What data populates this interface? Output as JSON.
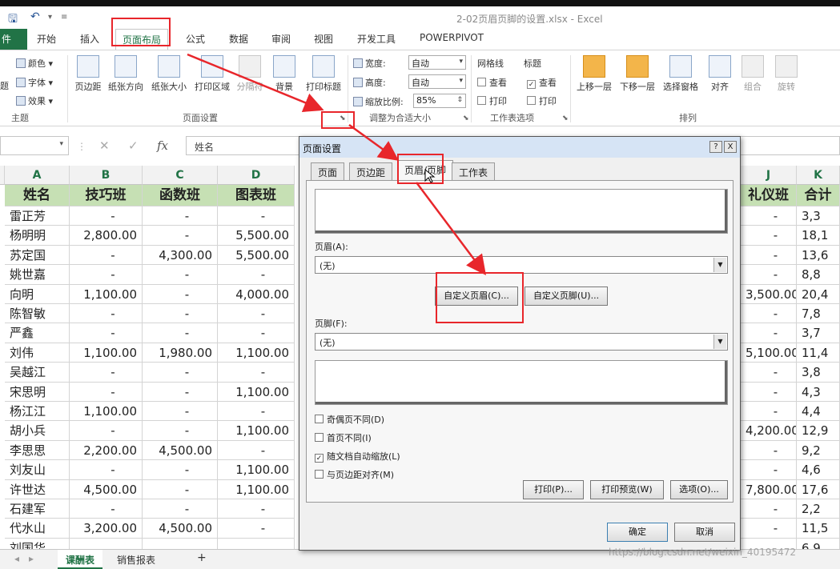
{
  "window": {
    "title": "2-02页眉页脚的设置.xlsx - Excel"
  },
  "ribbon_tabs": [
    "件",
    "开始",
    "插入",
    "页面布局",
    "公式",
    "数据",
    "审阅",
    "视图",
    "开发工具",
    "POWERPIVOT"
  ],
  "ribbon": {
    "theme": {
      "colors": "颜色 ▾",
      "fonts": "字体 ▾",
      "effects": "效果 ▾",
      "partial": "题",
      "group": "主题"
    },
    "page_setup": {
      "margins": "页边距",
      "orientation": "纸张方向",
      "size": "纸张大小",
      "print_area": "打印区域",
      "breaks": "分隔符",
      "background": "背景",
      "print_titles": "打印标题",
      "group": "页面设置"
    },
    "scale_to_fit": {
      "width_label": "宽度:",
      "width_value": "自动",
      "height_label": "高度:",
      "height_value": "自动",
      "scale_label": "缩放比例:",
      "scale_value": "85%",
      "group": "调整为合适大小"
    },
    "sheet_options": {
      "gridlines": "网格线",
      "headings": "标题",
      "view": "查看",
      "print": "打印",
      "group": "工作表选项"
    },
    "arrange": {
      "bring_forward": "上移一层",
      "send_backward": "下移一层",
      "selection_pane": "选择窗格",
      "align": "对齐",
      "group_btn": "组合",
      "rotate": "旋转",
      "group": "排列"
    }
  },
  "formula_bar": {
    "fx": "fx",
    "cancel": "✕",
    "enter": "✓",
    "content": "姓名"
  },
  "grid": {
    "columns": [
      "A",
      "B",
      "C",
      "D",
      "J",
      "K"
    ],
    "headers": [
      "姓名",
      "技巧班",
      "函数班",
      "图表班",
      "礼仪班",
      "合计"
    ],
    "rows": [
      [
        "雷正芳",
        "-",
        "-",
        "-",
        "-",
        "3,3"
      ],
      [
        "杨明明",
        "2,800.00",
        "-",
        "5,500.00",
        "-",
        "18,1"
      ],
      [
        "苏定国",
        "-",
        "4,300.00",
        "5,500.00",
        "-",
        "13,6"
      ],
      [
        "姚世嘉",
        "-",
        "-",
        "-",
        "-",
        "8,8"
      ],
      [
        "向明",
        "1,100.00",
        "-",
        "4,000.00",
        "3,500.00",
        "20,4"
      ],
      [
        "陈智敏",
        "-",
        "-",
        "-",
        "-",
        "7,8"
      ],
      [
        "严鑫",
        "-",
        "-",
        "-",
        "-",
        "3,7"
      ],
      [
        "刘伟",
        "1,100.00",
        "1,980.00",
        "1,100.00",
        "5,100.00",
        "11,4"
      ],
      [
        "吴越江",
        "-",
        "-",
        "-",
        "-",
        "3,8"
      ],
      [
        "宋思明",
        "-",
        "-",
        "1,100.00",
        "-",
        "4,3"
      ],
      [
        "杨江江",
        "1,100.00",
        "-",
        "-",
        "-",
        "4,4"
      ],
      [
        "胡小兵",
        "-",
        "-",
        "1,100.00",
        "4,200.00",
        "12,9"
      ],
      [
        "李思思",
        "2,200.00",
        "4,500.00",
        "-",
        "-",
        "9,2"
      ],
      [
        "刘友山",
        "-",
        "-",
        "1,100.00",
        "-",
        "4,6"
      ],
      [
        "许世达",
        "4,500.00",
        "-",
        "1,100.00",
        "7,800.00",
        "17,6"
      ],
      [
        "石建军",
        "-",
        "-",
        "-",
        "-",
        "2,2"
      ],
      [
        "代水山",
        "3,200.00",
        "4,500.00",
        "-",
        "-",
        "11,5"
      ],
      [
        "刘国华",
        "",
        "",
        "",
        "",
        "6,9"
      ]
    ]
  },
  "sheet_tabs": [
    "课酬表",
    "销售报表",
    "+"
  ],
  "dialog": {
    "title": "页面设置",
    "help": "?",
    "close": "X",
    "tabs": [
      "页面",
      "页边距",
      "页眉/页脚",
      "工作表"
    ],
    "header_label": "页眉(A):",
    "header_value": "(无)",
    "custom_header": "自定义页眉(C)...",
    "custom_footer": "自定义页脚(U)...",
    "footer_label": "页脚(F):",
    "footer_value": "(无)",
    "checkboxes": [
      {
        "label": "奇偶页不同(D)",
        "checked": false
      },
      {
        "label": "首页不同(I)",
        "checked": false
      },
      {
        "label": "随文档自动缩放(L)",
        "checked": true
      },
      {
        "label": "与页边距对齐(M)",
        "checked": false
      }
    ],
    "print": "打印(P)...",
    "print_preview": "打印预览(W)",
    "options": "选项(O)...",
    "ok": "确定",
    "cancel": "取消"
  },
  "watermark": "https://blog.csdn.net/weixin_40195472",
  "colors": {
    "excel_green": "#217346",
    "header_fill": "#c6e0b4",
    "annotation_red": "#e8262b"
  }
}
